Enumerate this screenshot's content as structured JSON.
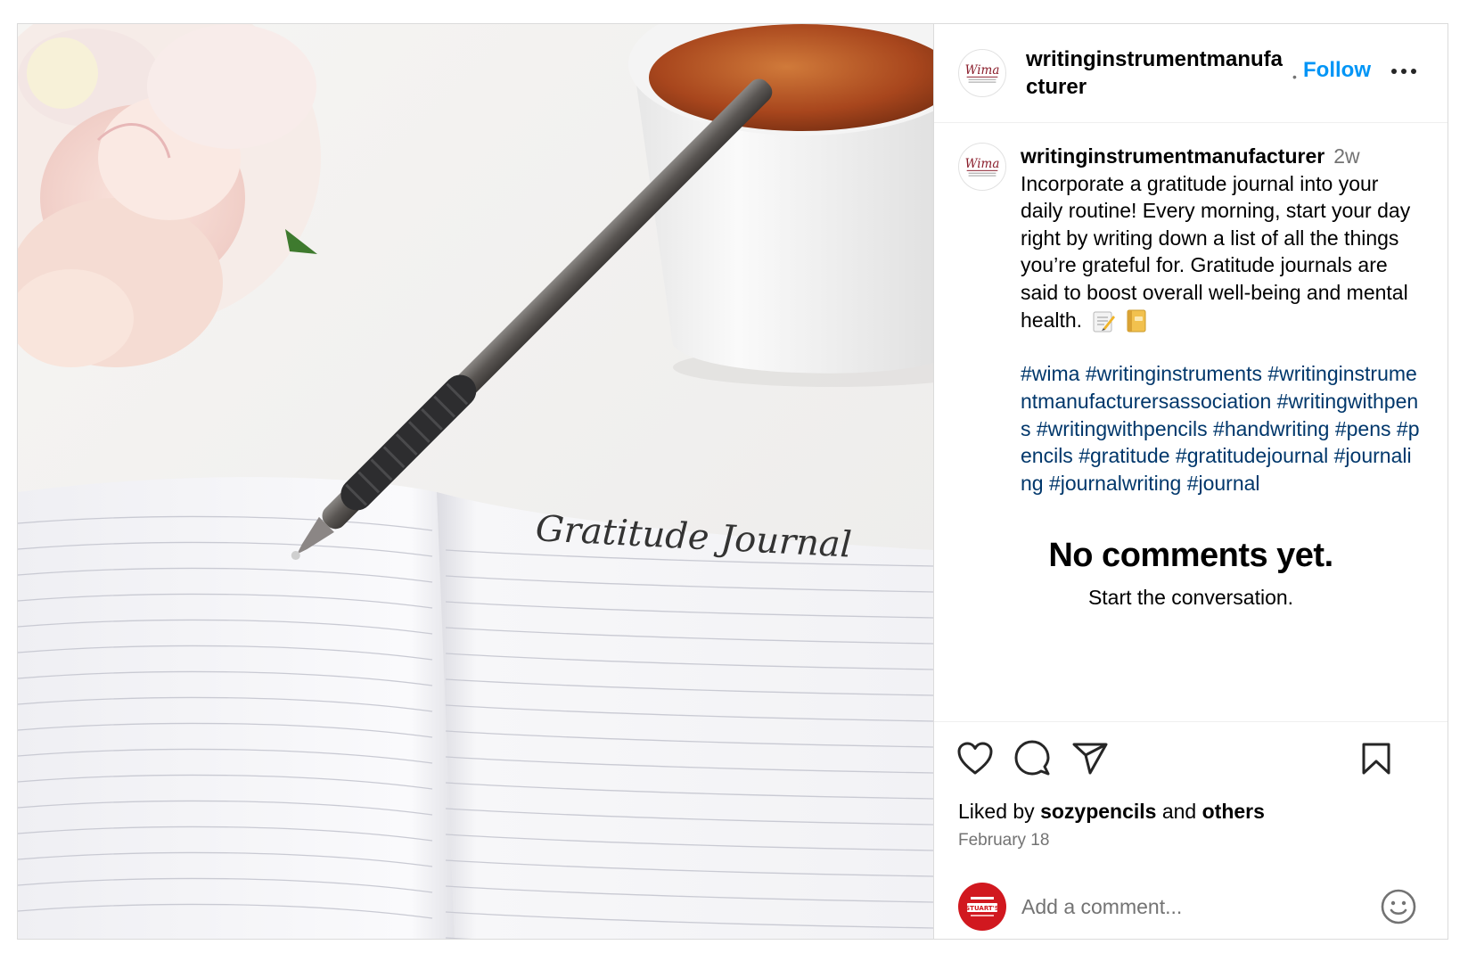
{
  "header": {
    "username": "writinginstrumentmanufacturer",
    "separator": "•",
    "follow_label": "Follow"
  },
  "caption": {
    "username": "writinginstrumentmanufacturer",
    "time_ago": "2w",
    "text": "Incorporate a gratitude journal into your daily routine! Every morning, start your day right by writing down a list of all the things you’re grateful for. Gratitude journals are said to boost overall well-being and mental health.",
    "emojis": [
      "memo",
      "notebook"
    ],
    "hashtags": [
      "#wima",
      "#writinginstruments",
      "#writinginstrumentmanufacturersassociation",
      "#writingwithpens",
      "#writingwithpencils",
      "#handwriting",
      "#pens",
      "#pencils",
      "#gratitude",
      "#gratitudejournal",
      "#journaling",
      "#journalwriting",
      "#journal"
    ]
  },
  "empty_state": {
    "title": "No comments yet.",
    "subtitle": "Start the conversation."
  },
  "engagement": {
    "liked_prefix": "Liked by",
    "liked_user": "sozypencils",
    "liked_and": "and",
    "liked_others": "others",
    "date": "February 18"
  },
  "comment": {
    "placeholder": "Add a comment..."
  },
  "photo": {
    "handwritten_text": "Gratitude Journal"
  },
  "logos": {
    "wima": "Wima",
    "stuart": "STUART'S"
  },
  "icons": [
    "heart-icon",
    "comment-icon",
    "share-icon",
    "bookmark-icon",
    "more-icon",
    "emoji-icon"
  ],
  "colors": {
    "follow": "#0095f6",
    "hashtag": "#00376b",
    "muted": "#737373",
    "border": "#dbdbdb",
    "stuart_red": "#d1181f"
  }
}
